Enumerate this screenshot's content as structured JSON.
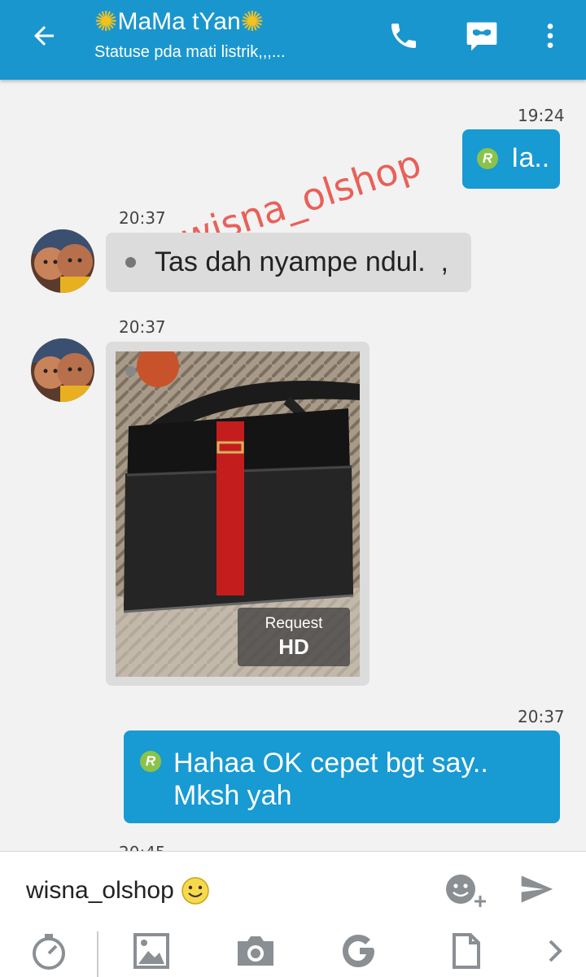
{
  "header": {
    "contact_name": "MaMa tYan",
    "status": "Statuse pda mati listrik,,,...",
    "icons": {
      "back": "back-arrow-icon",
      "call": "phone-icon",
      "video": "video-chat-icon",
      "menu": "more-vert-icon"
    },
    "burst_glyph": "✺"
  },
  "watermark": "wisna_olshop",
  "messages": [
    {
      "direction": "out",
      "time": "19:24",
      "text": "Ia..",
      "badge": "R"
    },
    {
      "direction": "in",
      "time": "20:37",
      "text": "Tas dah nyampe ndul.  ,"
    },
    {
      "direction": "in",
      "time": "20:37",
      "type": "image",
      "image_desc": "black bag with red strap",
      "overlay_top": "Request",
      "overlay_bottom": "HD"
    },
    {
      "direction": "out",
      "time": "20:37",
      "text_line1": "Hahaa OK cepet bgt say..",
      "text_line2": "Mksh yah",
      "badge": "R"
    },
    {
      "direction": "in",
      "time": "20:45"
    }
  ],
  "input": {
    "value": "wisna_olshop",
    "icons": {
      "emoji": "smiley-icon",
      "add_emoji": "add-emoticon-icon",
      "send": "send-icon"
    }
  },
  "toolbar": {
    "icons": [
      "timer-icon",
      "image-icon",
      "camera-icon",
      "google-icon",
      "file-icon",
      "chevron-right-icon"
    ]
  },
  "colors": {
    "header": "#1a96cf",
    "outgoing_bubble": "#189ad3",
    "incoming_bubble": "#dcdcdc",
    "watermark": "#e8473f",
    "badge": "#8bc34a"
  }
}
